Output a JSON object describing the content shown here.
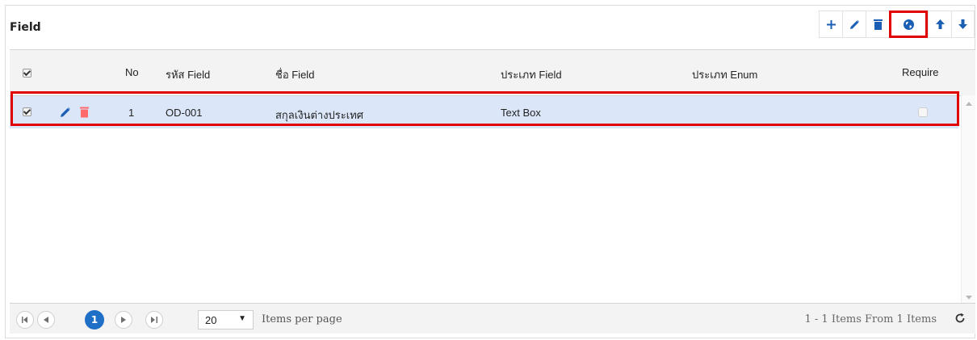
{
  "panel": {
    "title": "Field"
  },
  "toolbar": {
    "buttons": [
      {
        "name": "add",
        "icon": "plus-icon"
      },
      {
        "name": "edit",
        "icon": "pencil-icon"
      },
      {
        "name": "delete",
        "icon": "trash-icon"
      },
      {
        "name": "language",
        "icon": "globe-icon"
      },
      {
        "name": "move-up",
        "icon": "arrow-up-icon"
      },
      {
        "name": "move-down",
        "icon": "arrow-down-icon"
      }
    ]
  },
  "grid": {
    "columns": {
      "no": "No",
      "code": "รหัส Field",
      "name": "ชื่อ Field",
      "type": "ประเภท Field",
      "enum_type": "ประเภท Enum",
      "require": "Require"
    },
    "rows": [
      {
        "selected": true,
        "no": "1",
        "code": "OD-001",
        "name": "สกุลเงินต่างประเทศ",
        "type": "Text Box",
        "enum_type": "",
        "require": false
      }
    ]
  },
  "pager": {
    "current_page": "1",
    "page_size": "20",
    "items_per_page_label": "Items per page",
    "info": "1 - 1 Items From 1 Items"
  },
  "colors": {
    "accent": "#1e6fc5",
    "selected_row": "#dbe7f9",
    "highlight": "#e00000",
    "delete_red": "#ff6b6b",
    "edit_blue": "#1b5fb5"
  }
}
